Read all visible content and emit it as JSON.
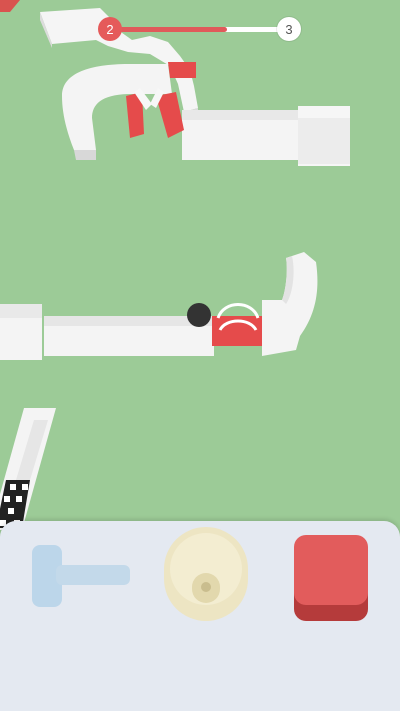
{
  "level_progress": {
    "current_level": "2",
    "next_level": "3",
    "progress": 0.65,
    "colors": {
      "done": "#e05a5a",
      "remaining": "#ffffff"
    }
  },
  "scene": {
    "background": "#9ccb97",
    "track_color": "#f4f4f4",
    "hazard_color": "#e54b4b",
    "ball_color": "#333333",
    "finish_pattern": "checkered"
  },
  "tools": [
    {
      "name": "hammer",
      "icon": "hammer-icon",
      "color": "#c3d9ea",
      "available": false
    },
    {
      "name": "spring",
      "icon": "spring-pad-icon",
      "color": "#ede5c3",
      "available": false
    },
    {
      "name": "push-button",
      "icon": "push-button-icon",
      "color": "#e25c5c",
      "available": true
    }
  ]
}
